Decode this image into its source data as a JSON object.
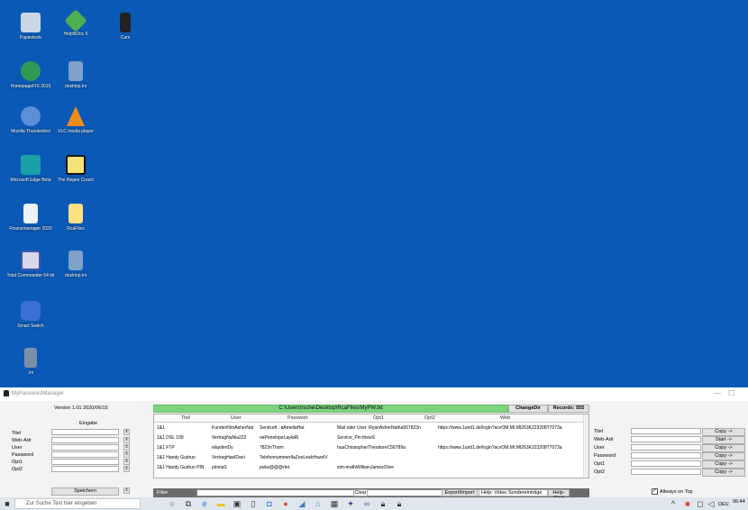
{
  "desktop": {
    "icons": [
      {
        "label": "Papierkorb",
        "icon": "recycle-bin-icon",
        "color": "#c9d6e6"
      },
      {
        "label": "HelpNDoc 6",
        "icon": "helpndoc-icon",
        "color": "#4caf50"
      },
      {
        "label": "Cam",
        "icon": "camera-app-icon",
        "color": "#222222"
      },
      {
        "label": "HomepageFIX 2016",
        "icon": "homepagefix-icon",
        "color": "#2e9a55"
      },
      {
        "label": "desktop.ini",
        "icon": "ini-file-icon",
        "color": "#7fa2c8"
      },
      {
        "label": "Mozilla Thunderbird",
        "icon": "thunderbird-icon",
        "color": "#5c8fd6"
      },
      {
        "label": "VLC media player",
        "icon": "vlc-icon",
        "color": "#f08c1b"
      },
      {
        "label": "Microsoft Edge Beta",
        "icon": "edge-beta-icon",
        "color": "#1ba0a8"
      },
      {
        "label": "The Regex Coach",
        "icon": "regex-coach-icon",
        "color": "#f4e27a"
      },
      {
        "label": "Finanzmanager 2020",
        "icon": "document-icon",
        "color": "#eef3f9"
      },
      {
        "label": "RcaFiles",
        "icon": "folder-icon",
        "color": "#ffe082"
      },
      {
        "label": "Total Commander 64 bit",
        "icon": "total-commander-icon",
        "color": "#d8d8e8"
      },
      {
        "label": "desktop.ini",
        "icon": "ini-file-icon",
        "color": "#7fa2c8"
      },
      {
        "label": "Smart Switch",
        "icon": "smart-switch-icon",
        "color": "#3a6fd6"
      },
      {
        "label": ".ini",
        "icon": "ini-file-icon",
        "color": "#7d8fa8"
      }
    ]
  },
  "window": {
    "title": "MyPasswordManager",
    "minimize": "—",
    "maximize": "☐",
    "version": "Version 1.01 2020/06/15",
    "eingabe_label": "Eingabe",
    "fields": [
      "Titel",
      "Web-Adr",
      "User",
      "Password",
      "Opt1",
      "Opt2"
    ],
    "clear_x": "x",
    "save_label": "Speichern",
    "path": "C:\\Users\\rsche\\Desktop\\RcaFiles\\MyPW.txt",
    "change_dir": "ChangeDir",
    "records": "Records: 555",
    "columns": [
      "Titel",
      "User",
      "Passwort",
      "Opt1",
      "Opt2",
      "Web"
    ],
    "rows": [
      [
        "1&1",
        "KundenNrnAsherNat",
        "Servicefr. :aAmeliaHar",
        "Mail oder User :RyanAsherNatha567823n",
        "",
        "https://www.1und1.de/login?acvOM.MI.MI263K223208T7073a"
      ],
      [
        "1&1 DSL 100",
        "VertragNaNia222",
        "oePenelopeLaylaRi",
        "Service_Pin:thewS",
        "",
        ""
      ],
      [
        "1&1 FTP",
        "elaydenDy",
        "7823nThom",
        "huaChristopherTheodoreC56789a",
        "",
        "https://www.1und1.de/login?acvOM.MI.MI263K223208T7073a"
      ],
      [
        "1&1 Handy Gudrun",
        "VertragHaelDani",
        "TelefonnummerIlaZoeLeahHazelV",
        "",
        "",
        ""
      ],
      [
        "1&1 Handy Gudrun PIN",
        "pinniaS",
        "puka@@@rlet",
        "sim-nrathWilliamJamesOlive",
        "",
        ""
      ]
    ],
    "filter_label": "Filter",
    "filter_value": "",
    "clear_label": "Clear",
    "export_label": "Export/Import",
    "help_select": "Help: Video Sondereinträge",
    "help_start": "Help-Start",
    "copy_label": "Copy ->",
    "start_label": "Start ->",
    "always_on_top": "Allways on Top",
    "always_on_top_checked": true
  },
  "taskbar": {
    "search_placeholder": "Zur Suche Text hier eingeben",
    "language": "DEU",
    "time": "06:44",
    "icons": [
      "cortana-icon",
      "task-view-icon",
      "edge-icon",
      "file-explorer-icon",
      "store-icon",
      "document-icon",
      "mail-icon",
      "chrome-icon",
      "app-icon",
      "shield-icon",
      "calculator-icon",
      "visual-studio-icon",
      "visual-studio-icon",
      "lock-icon",
      "lock-icon"
    ]
  },
  "colors": {
    "desktop": "#0a59b6",
    "path_bar": "#7fd27f",
    "filter_bar": "#6c6c6c"
  }
}
